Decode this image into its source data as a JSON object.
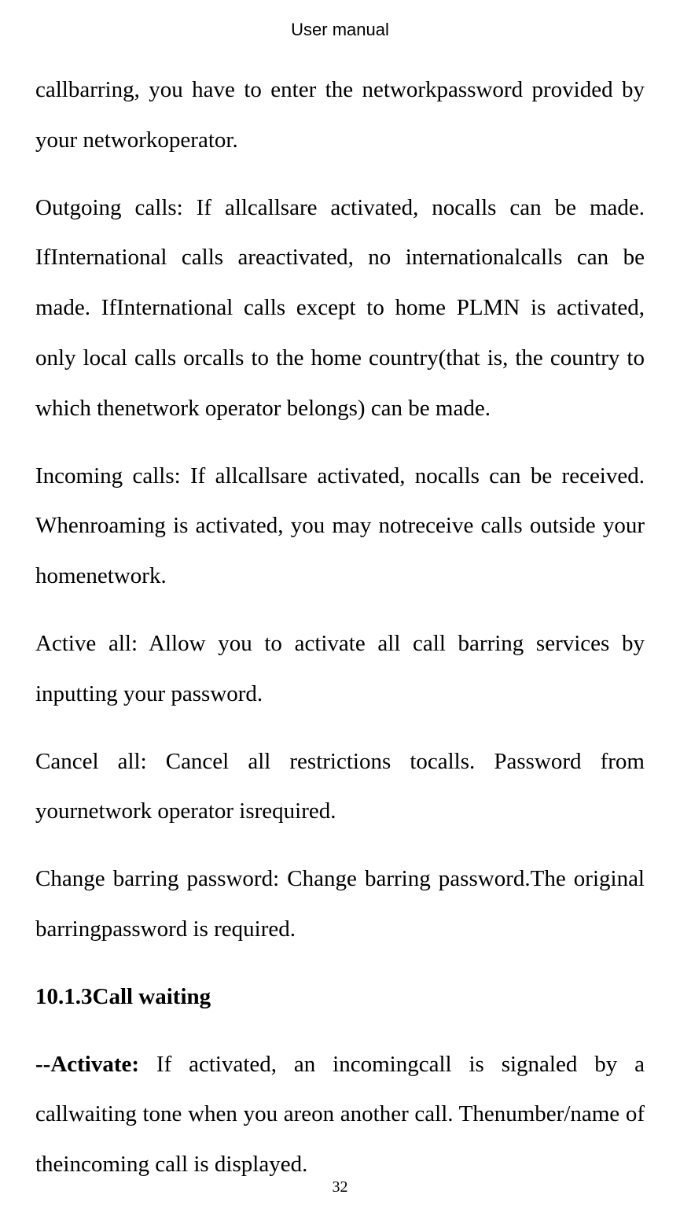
{
  "header": "User manual",
  "paragraphs": {
    "p1": "callbarring, you have to enter the networkpassword provided by your networkoperator.",
    "p2": "Outgoing calls: If allcallsare activated, nocalls can be made. IfInternational calls areactivated, no internationalcalls can be made. IfInternational calls except to home PLMN is activated, only local calls orcalls to the home country(that is, the country to which thenetwork operator belongs) can be made.",
    "p3": "Incoming calls: If allcallsare activated, nocalls can be received. Whenroaming is activated, you may notreceive calls outside your homenetwork.",
    "p4": "Active all: Allow you to activate all call barring services by inputting your password.",
    "p5": "Cancel all: Cancel all restrictions tocalls. Password from yournetwork operator isrequired.",
    "p6": "Change barring password: Change barring password.The original barringpassword is required.",
    "heading": "10.1.3Call waiting",
    "p7_bold": "--Activate: ",
    "p7_rest": "If activated, an incomingcall is signaled by a callwaiting tone when you areon another call. Thenumber/name of theincoming call is displayed."
  },
  "pageNumber": "32"
}
